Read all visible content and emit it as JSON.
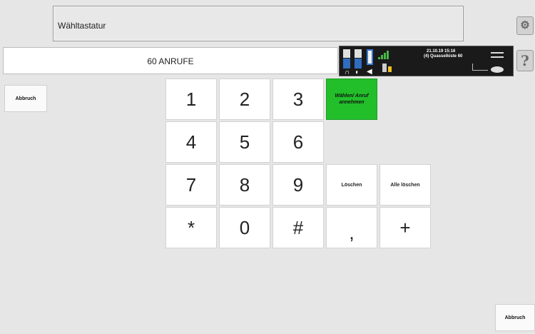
{
  "header": {
    "title": "Wähltastatur"
  },
  "calls": {
    "label": "60 ANRUFE"
  },
  "status": {
    "date_time": "21.10.19 15:16",
    "contact": "(4) Quasselkiste 60"
  },
  "buttons": {
    "cancel_left": "Abbruch",
    "cancel_right": "Abbruch",
    "help": "?",
    "dial": "Wählen/ Anruf annehmen",
    "delete": "Löschen",
    "delete_all": "Alle löschen"
  },
  "keypad": {
    "k1": "1",
    "k2": "2",
    "k3": "3",
    "k4": "4",
    "k5": "5",
    "k6": "6",
    "k7": "7",
    "k8": "8",
    "k9": "9",
    "kstar": "*",
    "k0": "0",
    "khash": "#",
    "kcomma": ",",
    "kplus": "+"
  },
  "icons": {
    "settings": "settings-icon",
    "help": "help-icon",
    "headset": "headset-icon",
    "signal": "signal-strength-icon",
    "battery": "battery-icon"
  },
  "colors": {
    "dial_button": "#22bf2a",
    "status_panel": "#1a1a1a"
  }
}
